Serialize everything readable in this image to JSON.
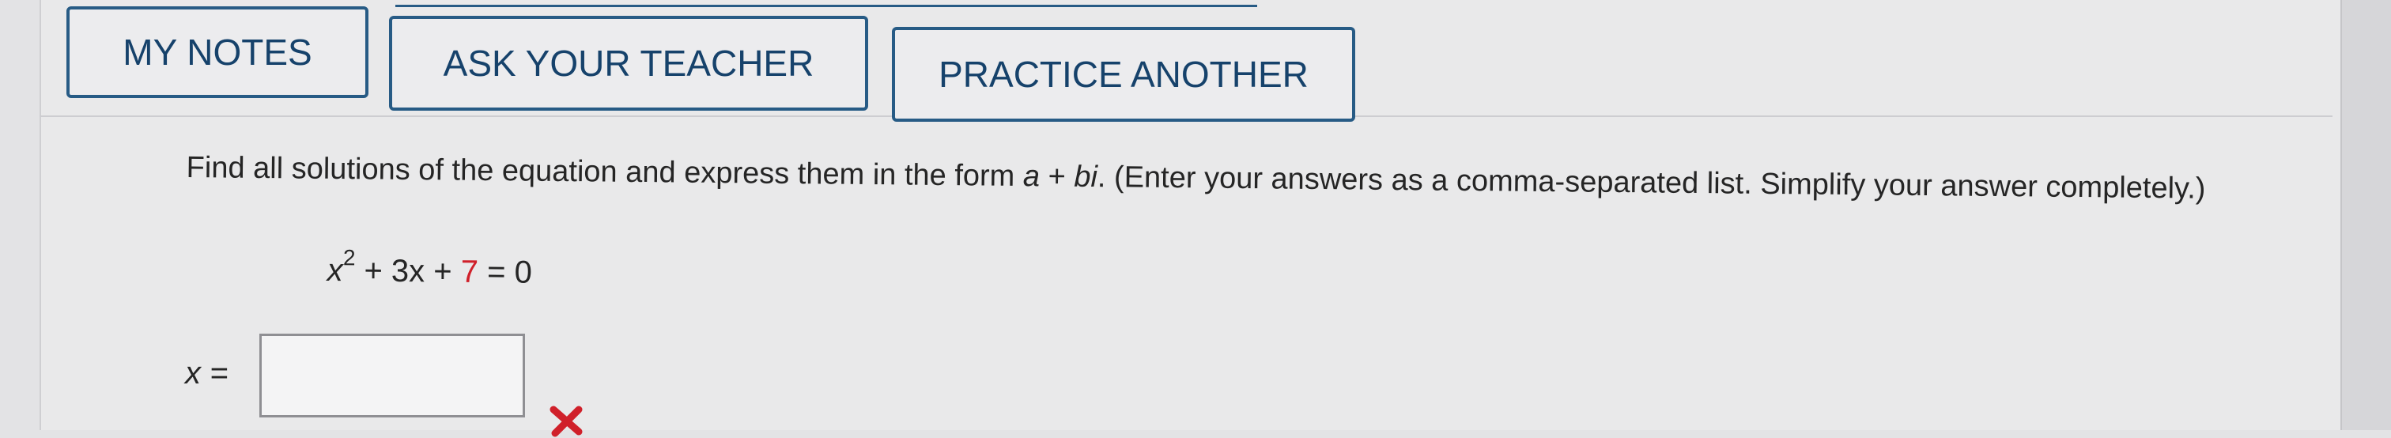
{
  "toolbar": {
    "my_notes_label": "MY NOTES",
    "ask_teacher_label": "ASK YOUR TEACHER",
    "practice_another_label": "PRACTICE ANOTHER"
  },
  "question": {
    "instructions_pre": "Find all solutions of the equation and express them in the form ",
    "form_a": "a",
    "form_plus": " + ",
    "form_bi": "bi",
    "instructions_post": ". (Enter your answers as a comma-separated list. Simplify your answer completely.)",
    "equation": {
      "x_term": "x",
      "x_exponent": "2",
      "middle": " + 3x + ",
      "constant": "7",
      "rhs": " = 0"
    },
    "answer_label": "x =",
    "answer_value": "",
    "status_icon": "red-x-icon",
    "status_color": "#d0202a"
  },
  "colors": {
    "button_border": "#275b85",
    "button_text": "#16426b",
    "highlight_red": "#d0202a"
  }
}
